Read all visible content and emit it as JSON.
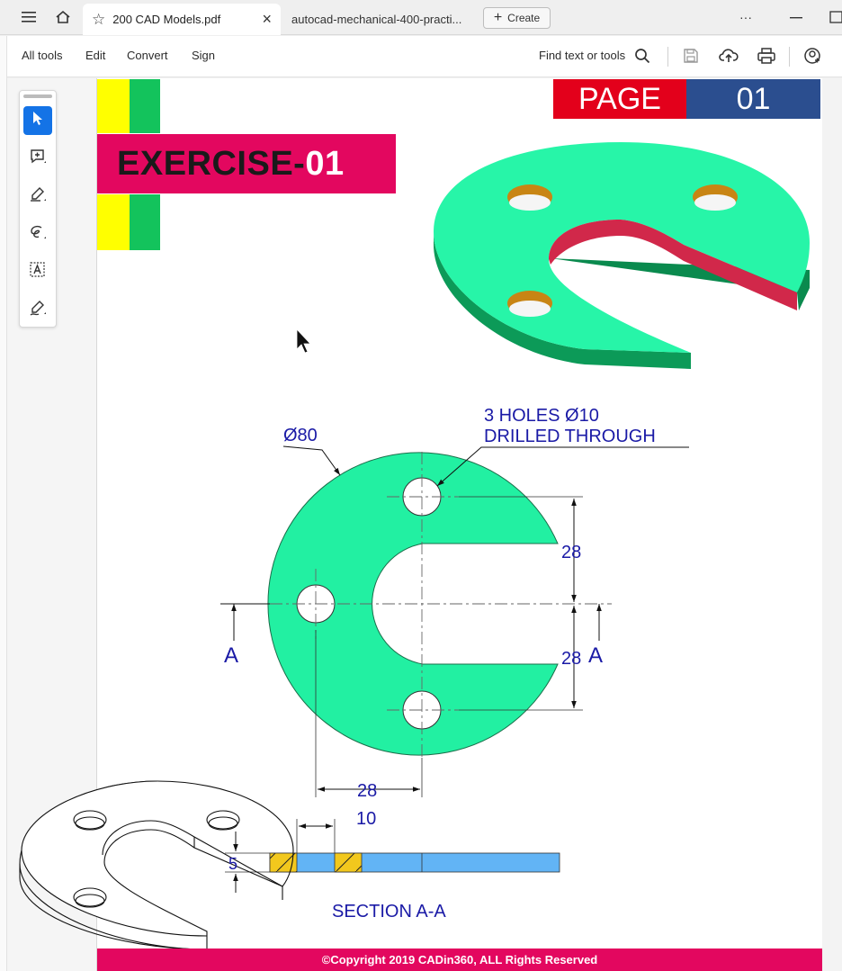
{
  "tabbar": {
    "tabs": [
      {
        "label": "200 CAD Models.pdf",
        "active": true
      },
      {
        "label": "autocad-mechanical-400-practi...",
        "active": false
      }
    ],
    "create_label": "Create",
    "more_label": "···"
  },
  "toolbar": {
    "menu": [
      "All tools",
      "Edit",
      "Convert",
      "Sign"
    ],
    "find_label": "Find text or tools"
  },
  "tool_panel": {
    "tools": [
      "select-icon",
      "add-comment-icon",
      "highlight-icon",
      "draw-freeform-icon",
      "text-select-icon",
      "sign-pen-icon"
    ],
    "active": "select-icon"
  },
  "document": {
    "exercise_prefix": "EXERCISE-",
    "exercise_number": "01",
    "page_label": "PAGE",
    "page_number": "01",
    "dim_diameter": "Ø80",
    "holes_note_1": "3 HOLES Ø10",
    "holes_note_2": "DRILLED THROUGH",
    "dim_28_upper": "28",
    "dim_28_lower": "28",
    "dim_28_bottom": "28",
    "dim_10": "10",
    "dim_5": "5",
    "section_left_label": "A",
    "section_right_label": "A",
    "section_title": "SECTION A-A",
    "footer": "©Copyright 2019 CADin360, ALL Rights Reserved"
  },
  "colors": {
    "accent": "#1473e6",
    "part_green": "#22f0a2",
    "magenta": "#e3075f",
    "page_red": "#e3001b",
    "page_blue": "#2b4e8f",
    "dimension_blue": "#1a1aa6"
  }
}
